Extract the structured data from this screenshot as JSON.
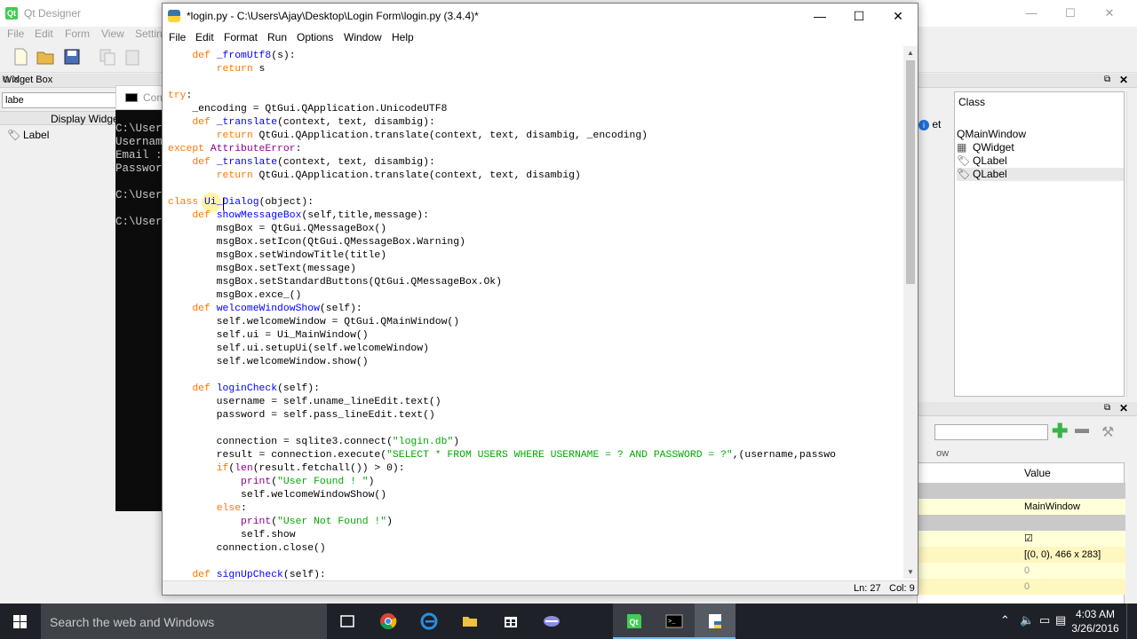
{
  "qt_designer": {
    "title": "Qt Designer",
    "menu": [
      "File",
      "Edit",
      "Form",
      "View",
      "Settin"
    ],
    "widget_box": {
      "title": "Widget Box",
      "filter_value": "labe",
      "category": "Display Widget",
      "item": "Label"
    },
    "object_inspector": {
      "column": "Class",
      "partial_text": "et",
      "rows": [
        "QMainWindow",
        "QWidget",
        "QLabel",
        "QLabel"
      ]
    },
    "property_editor": {
      "hint": "ow",
      "column": "Value",
      "rows": [
        "",
        "MainWindow",
        "",
        "☑",
        "[(0, 0), 466 x 283]",
        "0",
        "0"
      ]
    }
  },
  "console": {
    "title": "Com",
    "lines": [
      "C:\\User",
      "Usernam",
      "Email :",
      "Passwor",
      "",
      "C:\\User",
      "",
      "C:\\User"
    ]
  },
  "idle": {
    "title": "*login.py - C:\\Users\\Ajay\\Desktop\\Login Form\\login.py (3.4.4)*",
    "menu": [
      "File",
      "Edit",
      "Format",
      "Run",
      "Options",
      "Window",
      "Help"
    ],
    "status": {
      "line": "Ln: 27",
      "col": "Col: 9"
    }
  },
  "taskbar": {
    "search_placeholder": "Search the web and Windows",
    "time": "4:03 AM",
    "date": "3/26/2016"
  },
  "colors": {
    "keyword": "#ff7700",
    "def_name": "#0000ff",
    "string": "#00aa00",
    "builtin": "#900090",
    "taskbar": "#1e2128"
  }
}
